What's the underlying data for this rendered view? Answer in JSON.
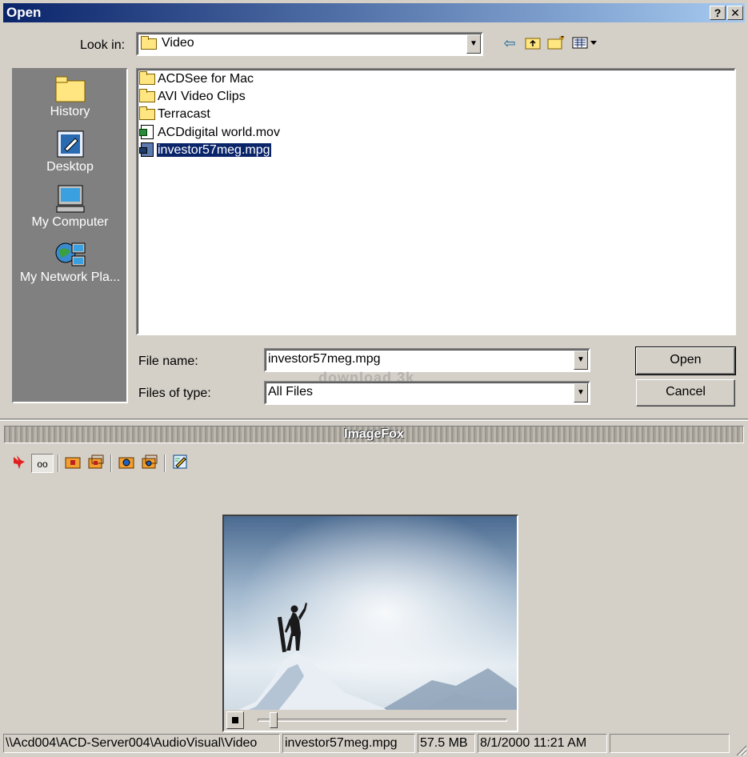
{
  "window": {
    "title": "Open",
    "help_label": "?",
    "close_label": "✕"
  },
  "toolbar": {
    "look_in_label": "Look in:",
    "look_in_value": "Video",
    "icons": [
      "back-arrow-icon",
      "up-folder-icon",
      "new-folder-icon",
      "view-menu-icon"
    ]
  },
  "places": [
    {
      "label": "History",
      "icon": "history-folder-icon"
    },
    {
      "label": "Desktop",
      "icon": "desktop-icon"
    },
    {
      "label": "My Computer",
      "icon": "my-computer-icon"
    },
    {
      "label": "My Network Pla...",
      "icon": "network-places-icon"
    }
  ],
  "files": [
    {
      "name": "ACDSee for Mac",
      "type": "folder",
      "selected": false
    },
    {
      "name": "AVI Video Clips",
      "type": "folder",
      "selected": false
    },
    {
      "name": "Terracast",
      "type": "folder",
      "selected": false
    },
    {
      "name": "ACDdigital world.mov",
      "type": "movie",
      "selected": false
    },
    {
      "name": "investor57meg.mpg",
      "type": "mpg",
      "selected": true
    }
  ],
  "form": {
    "file_name_label": "File name:",
    "file_name_value": "investor57meg.mpg",
    "file_type_label": "Files of type:",
    "file_type_value": "All Files",
    "open_label": "Open",
    "cancel_label": "Cancel"
  },
  "imagefox": {
    "title": "ImageFox",
    "tools": [
      "fox-logo-icon",
      "preview-toggle-icon",
      "folder-add-icon",
      "folder-multi-icon",
      "camera-folder-icon",
      "camera-multi-icon",
      "edit-note-icon"
    ],
    "preview_toggle_label": "oo"
  },
  "status": {
    "path": "\\\\Acd004\\ACD-Server004\\AudioVisual\\Video",
    "file": "investor57meg.mpg",
    "size": "57.5 MB",
    "date": "8/1/2000 11:21 AM"
  },
  "watermark": "download 3k",
  "player": {
    "position_fraction": 0.05
  }
}
